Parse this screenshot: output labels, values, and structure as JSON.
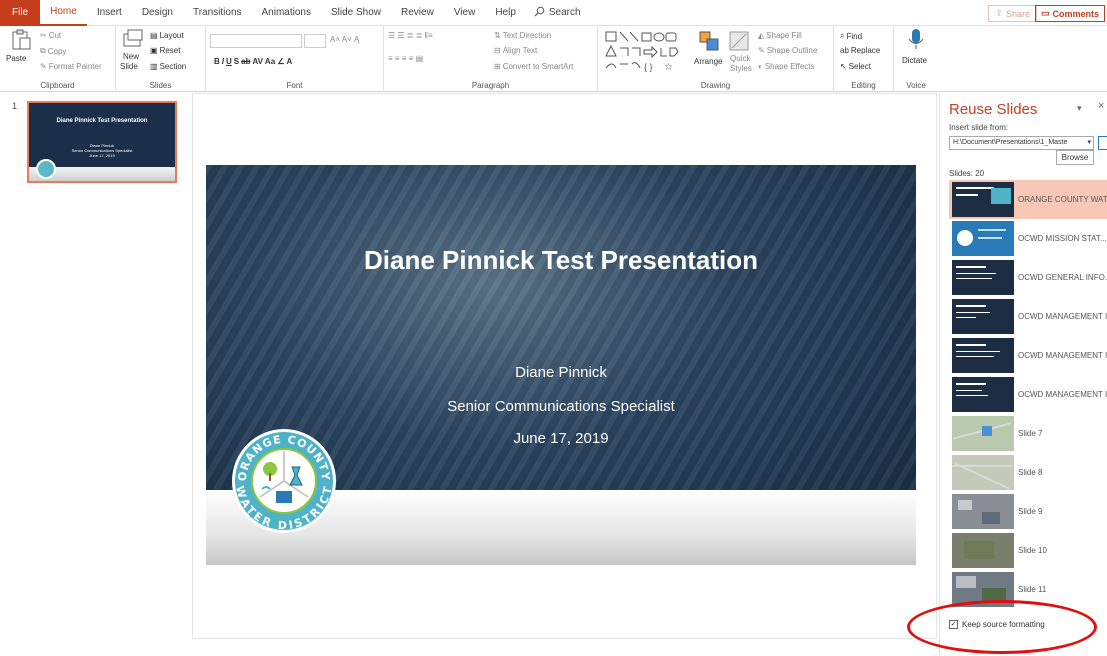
{
  "menu": {
    "file": "File",
    "tabs": [
      "Home",
      "Insert",
      "Design",
      "Transitions",
      "Animations",
      "Slide Show",
      "Review",
      "View",
      "Help"
    ],
    "search": "Search",
    "share": "Share",
    "comments": "Comments"
  },
  "ribbon": {
    "clipboard": {
      "paste": "Paste",
      "cut": "Cut",
      "copy": "Copy",
      "format_painter": "Format Painter",
      "label": "Clipboard"
    },
    "slides": {
      "new_slide_1": "New",
      "new_slide_2": "Slide",
      "layout": "Layout",
      "reset": "Reset",
      "section": "Section",
      "label": "Slides"
    },
    "font": {
      "label": "Font"
    },
    "paragraph": {
      "text_direction": "Text Direction",
      "align_text": "Align Text",
      "convert_smartart": "Convert to SmartArt",
      "label": "Paragraph"
    },
    "drawing": {
      "arrange": "Arrange",
      "quick_styles_1": "Quick",
      "quick_styles_2": "Styles",
      "shape_fill": "Shape Fill",
      "shape_outline": "Shape Outline",
      "shape_effects": "Shape Effects",
      "label": "Drawing"
    },
    "editing": {
      "find": "Find",
      "replace": "Replace",
      "select": "Select",
      "label": "Editing"
    },
    "voice": {
      "dictate": "Dictate",
      "label": "Voice"
    }
  },
  "thumbnail": {
    "number": "1",
    "title": "Diane Pinnick Test Presentation",
    "lines": [
      "Diane Pinnick",
      "Senior Communications Specialist",
      "June 17, 2019"
    ]
  },
  "slide": {
    "title": "Diane Pinnick Test Presentation",
    "name": "Diane Pinnick",
    "role": "Senior Communications Specialist",
    "date": "June 17, 2019",
    "logo_top": "ORANGE COUNTY",
    "logo_bottom": "WATER DISTRICT"
  },
  "reuse": {
    "title": "Reuse Slides",
    "insert_label": "Insert slide from:",
    "path": "H:\\Document\\Presentations\\1_Maste",
    "browse": "Browse",
    "count": "Slides: 20",
    "items": [
      "ORANGE COUNTY WAT",
      "OCWD MISSION STAT...",
      "OCWD GENERAL INFO...",
      "OCWD MANAGEMENT I",
      "OCWD MANAGEMENT I",
      "OCWD MANAGEMENT I",
      "Slide 7",
      "Slide 8",
      "Slide 9",
      "Slide 10",
      "Slide 11"
    ],
    "keep_source": "Keep source formatting",
    "keep_checked": "✓"
  },
  "colors": {
    "accent": "#c43e1c",
    "highlight_ring": "#e01010",
    "slide_bg": "#1c2f4a"
  }
}
